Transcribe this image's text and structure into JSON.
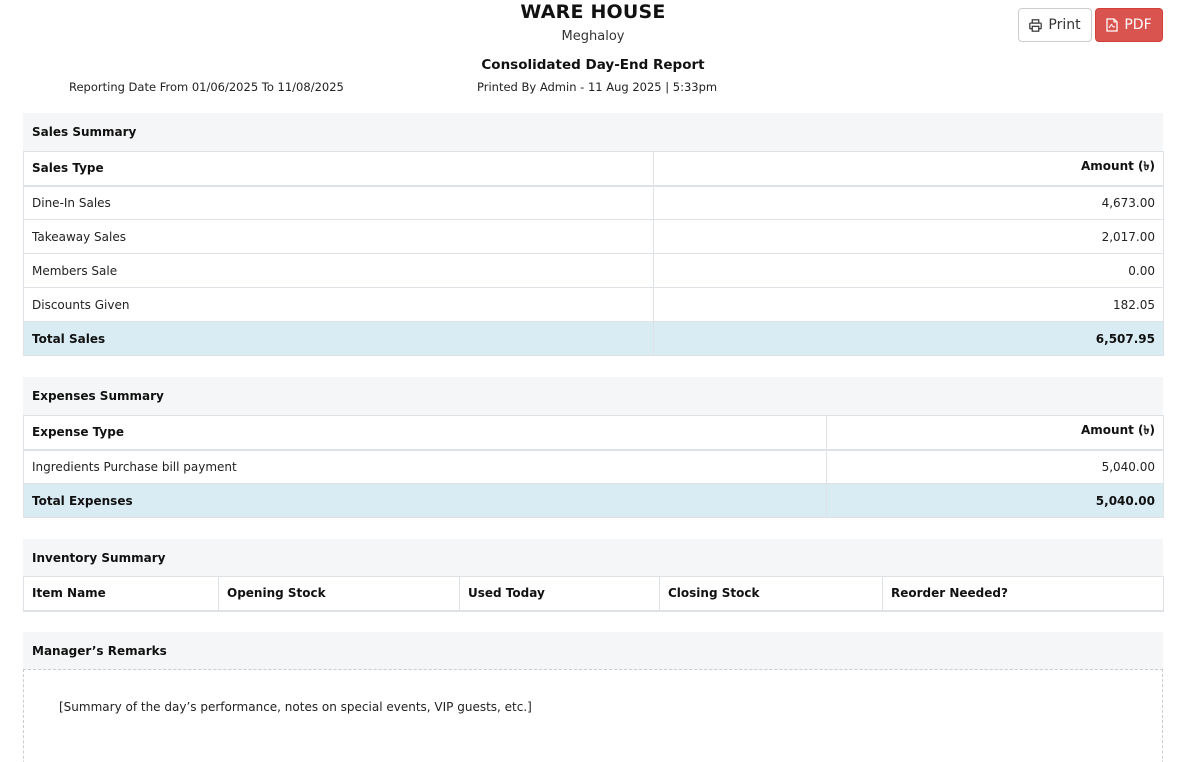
{
  "header": {
    "company": "WARE HOUSE",
    "branch": "Meghaloy",
    "report_title": "Consolidated Day-End Report",
    "date_range": "Reporting Date From 01/06/2025 To 11/08/2025",
    "printed_by": "Printed By Admin - 11 Aug 2025 | 5:33pm"
  },
  "toolbar": {
    "print_label": "Print",
    "pdf_label": "PDF",
    "print_icon": "printer-icon",
    "pdf_icon": "file-pdf-icon"
  },
  "sales": {
    "title": "Sales Summary",
    "col_type": "Sales Type",
    "col_amount": "Amount (৳)",
    "rows": [
      {
        "type": "Dine-In Sales",
        "amount": "4,673.00"
      },
      {
        "type": "Takeaway Sales",
        "amount": "2,017.00"
      },
      {
        "type": "Members Sale",
        "amount": "0.00"
      },
      {
        "type": "Discounts Given",
        "amount": "182.05"
      }
    ],
    "total_label": "Total Sales",
    "total_amount": "6,507.95"
  },
  "expenses": {
    "title": "Expenses Summary",
    "col_type": "Expense Type",
    "col_amount": "Amount (৳)",
    "rows": [
      {
        "type": "Ingredients Purchase bill payment",
        "amount": "5,040.00"
      }
    ],
    "total_label": "Total Expenses",
    "total_amount": "5,040.00"
  },
  "inventory": {
    "title": "Inventory Summary",
    "columns": [
      "Item Name",
      "Opening Stock",
      "Used Today",
      "Closing Stock",
      "Reorder Needed?"
    ]
  },
  "remarks": {
    "title": "Manager’s Remarks",
    "text": "[Summary of the day’s performance, notes on special events, VIP guests, etc.]"
  },
  "colors": {
    "pdf_button": "#d9534f",
    "total_row": "#d9ecf4",
    "section_head": "#f5f6f7"
  }
}
